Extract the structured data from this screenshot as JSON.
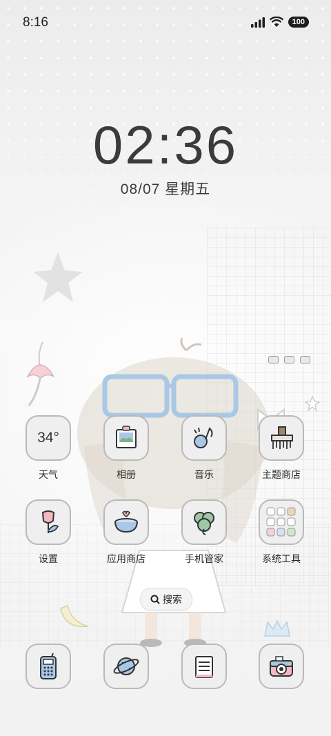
{
  "status_bar": {
    "time": "8:16",
    "battery": "100"
  },
  "lockclock": {
    "time": "02:36",
    "date": "08/07 星期五"
  },
  "weather": {
    "temp": "34°"
  },
  "apps_row1": [
    {
      "label": "天气"
    },
    {
      "label": "相册"
    },
    {
      "label": "音乐"
    },
    {
      "label": "主题商店"
    }
  ],
  "apps_row2": [
    {
      "label": "设置"
    },
    {
      "label": "应用商店"
    },
    {
      "label": "手机管家"
    },
    {
      "label": "系统工具"
    }
  ],
  "search": {
    "label": "搜索"
  },
  "dock": [
    {
      "icon": "phone-icon"
    },
    {
      "icon": "browser-icon"
    },
    {
      "icon": "notes-icon"
    },
    {
      "icon": "camera-icon"
    }
  ],
  "colors": {
    "tile_bg": "#efefef",
    "tile_border": "#b9b9b9",
    "text": "#2a2a2a",
    "accent_blue": "#a9c8e6"
  }
}
